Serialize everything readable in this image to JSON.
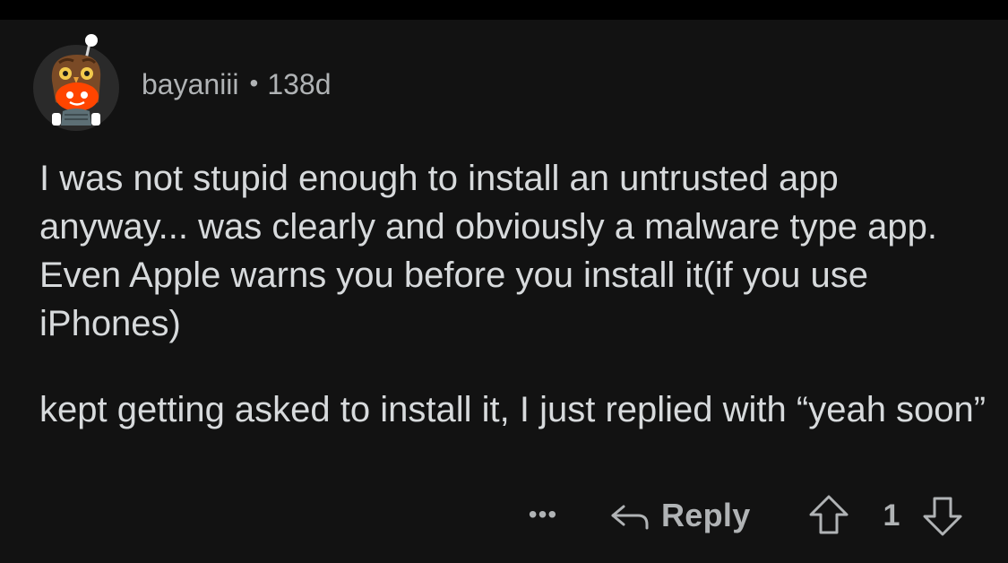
{
  "comment": {
    "author": "bayaniii",
    "separator": "•",
    "age": "138d",
    "avatar_icon": "snoo-owl-avatar-icon",
    "body_paragraphs": [
      "I was not stupid enough to install an untrusted app anyway... was clearly and obviously a malware type app. Even Apple warns you before you install it(if you use iPhones)",
      "kept getting asked to install it, I just replied with “yeah soon”"
    ]
  },
  "actions": {
    "more_label": "•••",
    "more_icon": "more-options-icon",
    "reply_icon": "reply-arrow-icon",
    "reply_label": "Reply",
    "upvote_icon": "upvote-arrow-icon",
    "vote_count": "1",
    "downvote_icon": "downvote-arrow-icon"
  },
  "colors": {
    "background": "#000000",
    "card": "#121212",
    "text": "#d7dadc",
    "muted": "#b0b3b5",
    "avatar_orange": "#ff4500"
  }
}
